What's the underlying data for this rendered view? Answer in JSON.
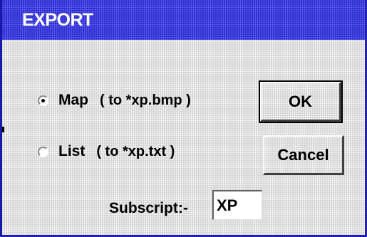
{
  "dialog": {
    "title": "EXPORT"
  },
  "options": {
    "map": {
      "label": "Map",
      "hint": "( to *xp.bmp )",
      "selected": true
    },
    "list": {
      "label": "List",
      "hint": "( to *xp.txt )",
      "selected": false
    }
  },
  "buttons": {
    "ok_label": "OK",
    "cancel_label": "Cancel"
  },
  "subscript": {
    "label": "Subscript:-",
    "value": "XP"
  },
  "colors": {
    "title_bar": "#2828c8",
    "dialog_face": "#d0d0d0"
  }
}
